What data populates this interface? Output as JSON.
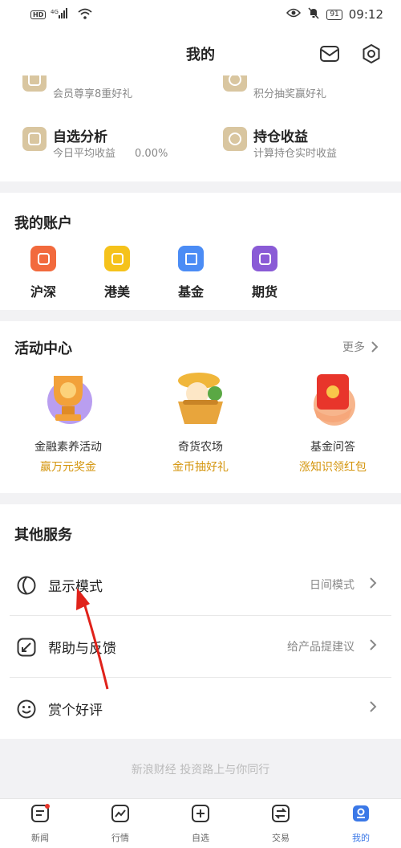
{
  "status_bar": {
    "network": "HD",
    "signal": "4G",
    "battery": "91",
    "time": "09:12"
  },
  "header": {
    "title": "我的"
  },
  "top_features": [
    {
      "title": "",
      "desc": "会员尊享8重好礼"
    },
    {
      "title": "",
      "desc": "积分抽奖赢好礼"
    },
    {
      "title": "自选分析",
      "desc": "今日平均收益",
      "value": "0.00%"
    },
    {
      "title": "持仓收益",
      "desc": "计算持仓实时收益"
    }
  ],
  "accounts": {
    "title": "我的账户",
    "items": [
      {
        "label": "沪深",
        "color": "#f26a3d"
      },
      {
        "label": "港美",
        "color": "#f5c21b"
      },
      {
        "label": "基金",
        "color": "#4b8cf5"
      },
      {
        "label": "期货",
        "color": "#8a5bd6"
      }
    ]
  },
  "activities": {
    "title": "活动中心",
    "more": "更多",
    "items": [
      {
        "name": "金融素养活动",
        "sub": "赢万元奖金"
      },
      {
        "name": "奇货农场",
        "sub": "金币抽好礼"
      },
      {
        "name": "基金问答",
        "sub": "涨知识领红包"
      }
    ]
  },
  "services": {
    "title": "其他服务",
    "items": [
      {
        "label": "显示模式",
        "value": "日间模式"
      },
      {
        "label": "帮助与反馈",
        "value": "给产品提建议"
      },
      {
        "label": "赏个好评",
        "value": ""
      }
    ]
  },
  "slogan": "新浪财经 投资路上与你同行",
  "nav": [
    {
      "label": "新闻"
    },
    {
      "label": "行情"
    },
    {
      "label": "自选"
    },
    {
      "label": "交易"
    },
    {
      "label": "我的"
    }
  ],
  "colors": {
    "accent_gold": "#d4950d",
    "active_blue": "#3b78e7",
    "feature_tan": "#d9c6a0"
  }
}
